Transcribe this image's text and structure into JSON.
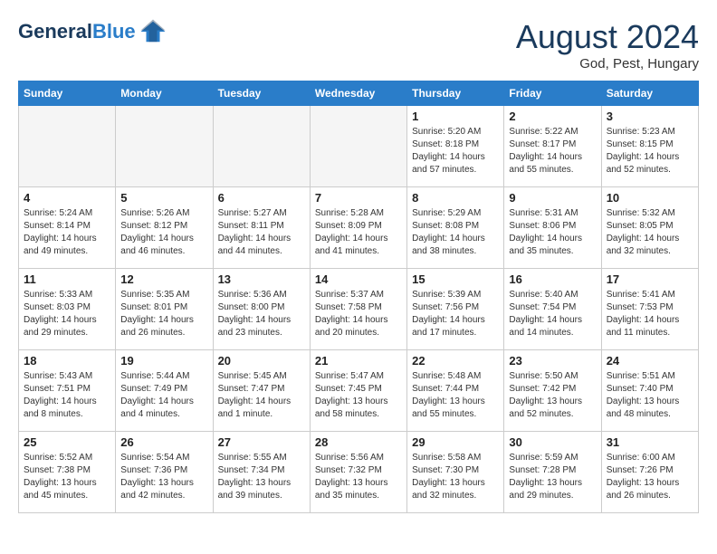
{
  "header": {
    "logo_line1": "General",
    "logo_line2": "Blue",
    "month_year": "August 2024",
    "location": "God, Pest, Hungary"
  },
  "weekdays": [
    "Sunday",
    "Monday",
    "Tuesday",
    "Wednesday",
    "Thursday",
    "Friday",
    "Saturday"
  ],
  "weeks": [
    [
      {
        "day": "",
        "empty": true
      },
      {
        "day": "",
        "empty": true
      },
      {
        "day": "",
        "empty": true
      },
      {
        "day": "",
        "empty": true
      },
      {
        "day": "1",
        "sunrise": "Sunrise: 5:20 AM",
        "sunset": "Sunset: 8:18 PM",
        "daylight": "Daylight: 14 hours and 57 minutes."
      },
      {
        "day": "2",
        "sunrise": "Sunrise: 5:22 AM",
        "sunset": "Sunset: 8:17 PM",
        "daylight": "Daylight: 14 hours and 55 minutes."
      },
      {
        "day": "3",
        "sunrise": "Sunrise: 5:23 AM",
        "sunset": "Sunset: 8:15 PM",
        "daylight": "Daylight: 14 hours and 52 minutes."
      }
    ],
    [
      {
        "day": "4",
        "sunrise": "Sunrise: 5:24 AM",
        "sunset": "Sunset: 8:14 PM",
        "daylight": "Daylight: 14 hours and 49 minutes."
      },
      {
        "day": "5",
        "sunrise": "Sunrise: 5:26 AM",
        "sunset": "Sunset: 8:12 PM",
        "daylight": "Daylight: 14 hours and 46 minutes."
      },
      {
        "day": "6",
        "sunrise": "Sunrise: 5:27 AM",
        "sunset": "Sunset: 8:11 PM",
        "daylight": "Daylight: 14 hours and 44 minutes."
      },
      {
        "day": "7",
        "sunrise": "Sunrise: 5:28 AM",
        "sunset": "Sunset: 8:09 PM",
        "daylight": "Daylight: 14 hours and 41 minutes."
      },
      {
        "day": "8",
        "sunrise": "Sunrise: 5:29 AM",
        "sunset": "Sunset: 8:08 PM",
        "daylight": "Daylight: 14 hours and 38 minutes."
      },
      {
        "day": "9",
        "sunrise": "Sunrise: 5:31 AM",
        "sunset": "Sunset: 8:06 PM",
        "daylight": "Daylight: 14 hours and 35 minutes."
      },
      {
        "day": "10",
        "sunrise": "Sunrise: 5:32 AM",
        "sunset": "Sunset: 8:05 PM",
        "daylight": "Daylight: 14 hours and 32 minutes."
      }
    ],
    [
      {
        "day": "11",
        "sunrise": "Sunrise: 5:33 AM",
        "sunset": "Sunset: 8:03 PM",
        "daylight": "Daylight: 14 hours and 29 minutes."
      },
      {
        "day": "12",
        "sunrise": "Sunrise: 5:35 AM",
        "sunset": "Sunset: 8:01 PM",
        "daylight": "Daylight: 14 hours and 26 minutes."
      },
      {
        "day": "13",
        "sunrise": "Sunrise: 5:36 AM",
        "sunset": "Sunset: 8:00 PM",
        "daylight": "Daylight: 14 hours and 23 minutes."
      },
      {
        "day": "14",
        "sunrise": "Sunrise: 5:37 AM",
        "sunset": "Sunset: 7:58 PM",
        "daylight": "Daylight: 14 hours and 20 minutes."
      },
      {
        "day": "15",
        "sunrise": "Sunrise: 5:39 AM",
        "sunset": "Sunset: 7:56 PM",
        "daylight": "Daylight: 14 hours and 17 minutes."
      },
      {
        "day": "16",
        "sunrise": "Sunrise: 5:40 AM",
        "sunset": "Sunset: 7:54 PM",
        "daylight": "Daylight: 14 hours and 14 minutes."
      },
      {
        "day": "17",
        "sunrise": "Sunrise: 5:41 AM",
        "sunset": "Sunset: 7:53 PM",
        "daylight": "Daylight: 14 hours and 11 minutes."
      }
    ],
    [
      {
        "day": "18",
        "sunrise": "Sunrise: 5:43 AM",
        "sunset": "Sunset: 7:51 PM",
        "daylight": "Daylight: 14 hours and 8 minutes."
      },
      {
        "day": "19",
        "sunrise": "Sunrise: 5:44 AM",
        "sunset": "Sunset: 7:49 PM",
        "daylight": "Daylight: 14 hours and 4 minutes."
      },
      {
        "day": "20",
        "sunrise": "Sunrise: 5:45 AM",
        "sunset": "Sunset: 7:47 PM",
        "daylight": "Daylight: 14 hours and 1 minute."
      },
      {
        "day": "21",
        "sunrise": "Sunrise: 5:47 AM",
        "sunset": "Sunset: 7:45 PM",
        "daylight": "Daylight: 13 hours and 58 minutes."
      },
      {
        "day": "22",
        "sunrise": "Sunrise: 5:48 AM",
        "sunset": "Sunset: 7:44 PM",
        "daylight": "Daylight: 13 hours and 55 minutes."
      },
      {
        "day": "23",
        "sunrise": "Sunrise: 5:50 AM",
        "sunset": "Sunset: 7:42 PM",
        "daylight": "Daylight: 13 hours and 52 minutes."
      },
      {
        "day": "24",
        "sunrise": "Sunrise: 5:51 AM",
        "sunset": "Sunset: 7:40 PM",
        "daylight": "Daylight: 13 hours and 48 minutes."
      }
    ],
    [
      {
        "day": "25",
        "sunrise": "Sunrise: 5:52 AM",
        "sunset": "Sunset: 7:38 PM",
        "daylight": "Daylight: 13 hours and 45 minutes."
      },
      {
        "day": "26",
        "sunrise": "Sunrise: 5:54 AM",
        "sunset": "Sunset: 7:36 PM",
        "daylight": "Daylight: 13 hours and 42 minutes."
      },
      {
        "day": "27",
        "sunrise": "Sunrise: 5:55 AM",
        "sunset": "Sunset: 7:34 PM",
        "daylight": "Daylight: 13 hours and 39 minutes."
      },
      {
        "day": "28",
        "sunrise": "Sunrise: 5:56 AM",
        "sunset": "Sunset: 7:32 PM",
        "daylight": "Daylight: 13 hours and 35 minutes."
      },
      {
        "day": "29",
        "sunrise": "Sunrise: 5:58 AM",
        "sunset": "Sunset: 7:30 PM",
        "daylight": "Daylight: 13 hours and 32 minutes."
      },
      {
        "day": "30",
        "sunrise": "Sunrise: 5:59 AM",
        "sunset": "Sunset: 7:28 PM",
        "daylight": "Daylight: 13 hours and 29 minutes."
      },
      {
        "day": "31",
        "sunrise": "Sunrise: 6:00 AM",
        "sunset": "Sunset: 7:26 PM",
        "daylight": "Daylight: 13 hours and 26 minutes."
      }
    ]
  ]
}
